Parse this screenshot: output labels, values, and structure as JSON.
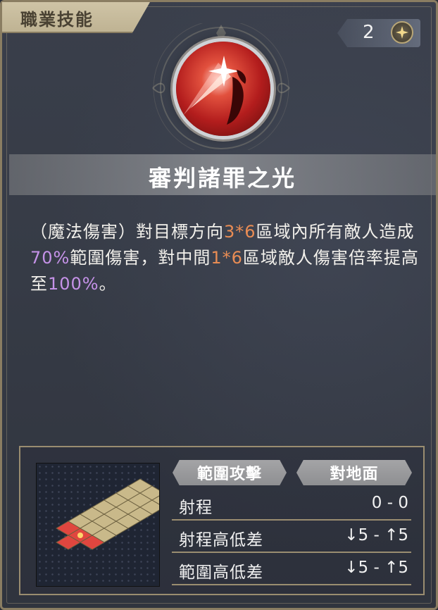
{
  "header": {
    "label": "職業技能"
  },
  "counter": {
    "value": "2",
    "icon": "sparkle-icon"
  },
  "skill": {
    "icon": "skill-light-judgement-icon",
    "title": "審判諸罪之光",
    "description": {
      "p1": "（魔法傷害）對目標方向",
      "v1": "3*6",
      "p2": "區域內所有敵人造成",
      "v2": "70%",
      "p3": "範圍傷害，對中間",
      "v3": "1*6",
      "p4": "區域敵人傷害倍率提高至",
      "v4": "100%",
      "p5": "。"
    }
  },
  "info": {
    "tags": [
      "範圍攻擊",
      "對地面"
    ],
    "stats": [
      {
        "label": "射程",
        "value": "0 - 0"
      },
      {
        "label": "射程高低差",
        "value": "↓5 - ↑5"
      },
      {
        "label": "範圍高低差",
        "value": "↓5 - ↑5"
      }
    ]
  },
  "colors": {
    "frame": "#8a7d62",
    "highlight_orange": "#e98c54",
    "highlight_purple": "#c592e8",
    "grid_tile": "#c9b98a",
    "grid_target": "#e0463f"
  }
}
